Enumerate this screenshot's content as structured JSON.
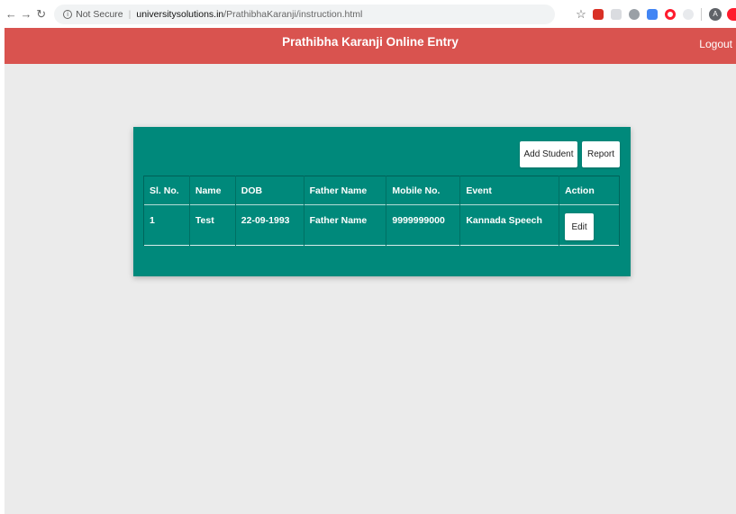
{
  "browser": {
    "not_secure": "Not Secure",
    "url_domain": "universitysolutions.in",
    "url_path": "/PrathibhaKaranji/instruction.html",
    "avatar_letter": "A"
  },
  "header": {
    "title": "Prathibha Karanji Online Entry",
    "logout_label": "Logout",
    "color": "#d9534f"
  },
  "panel": {
    "color": "#00897b",
    "add_student_label": "Add Student",
    "report_label": "Report"
  },
  "table": {
    "columns": [
      "Sl. No.",
      "Name",
      "DOB",
      "Father Name",
      "Mobile No.",
      "Event",
      "Action"
    ],
    "rows": [
      {
        "sl_no": "1",
        "name": "Test",
        "dob": "22-09-1993",
        "father_name": "Father Name",
        "mobile": "9999999000",
        "event": "Kannada Speech",
        "action_label": "Edit"
      }
    ]
  }
}
